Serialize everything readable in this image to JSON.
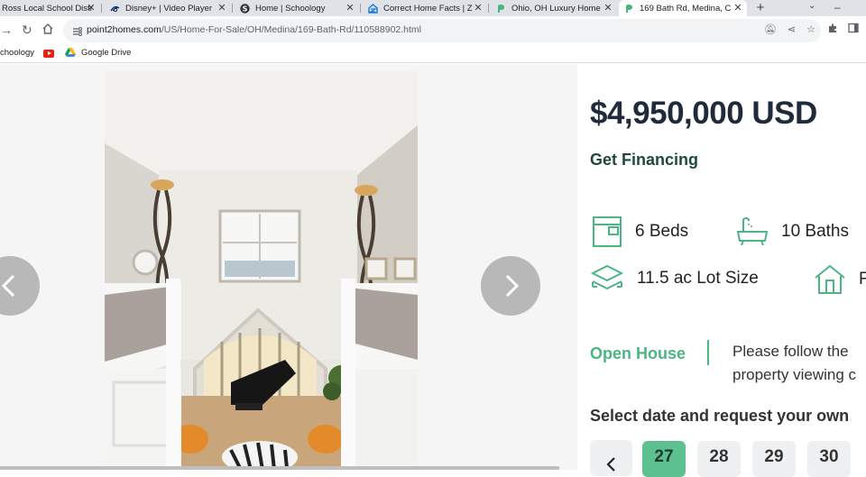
{
  "browser": {
    "tabs": [
      {
        "title": "Ross Local School Distr",
        "favicon": "school-icon",
        "active": false
      },
      {
        "title": "Disney+ | Video Player",
        "favicon": "disney-icon",
        "active": false
      },
      {
        "title": "Home | Schoology",
        "favicon": "schoology-icon",
        "active": false
      },
      {
        "title": "Correct Home Facts | Z",
        "favicon": "zillow-icon",
        "active": false
      },
      {
        "title": "Ohio, OH Luxury Home",
        "favicon": "point2-icon",
        "active": false
      },
      {
        "title": "169 Bath Rd, Medina, C",
        "favicon": "point2-icon",
        "active": true
      }
    ],
    "url_host": "point2homes.com",
    "url_path": "/US/Home-For-Sale/OH/Medina/169-Bath-Rd/110588902.html",
    "bookmarks": [
      {
        "label": "choology",
        "icon": "schoology-icon"
      },
      {
        "label": "",
        "icon": "youtube-icon"
      },
      {
        "label": "Google Drive",
        "icon": "google-drive-icon"
      }
    ]
  },
  "listing": {
    "price": "$4,950,000 USD",
    "financing_label": "Get Financing",
    "features": {
      "beds": "6 Beds",
      "baths": "10 Baths",
      "lot": "11.5 ac Lot Size",
      "type_partial": "F"
    },
    "open_house_label": "Open House",
    "open_house_text_line1": "Please follow the",
    "open_house_text_line2": "property viewing c",
    "select_date_label": "Select date and request your own",
    "dates": [
      "27",
      "28",
      "29",
      "30"
    ],
    "selected_date": "27"
  },
  "colors": {
    "accent_green": "#4cb584",
    "price_text": "#1f2a3a",
    "financing_text": "#1d4a3c"
  }
}
